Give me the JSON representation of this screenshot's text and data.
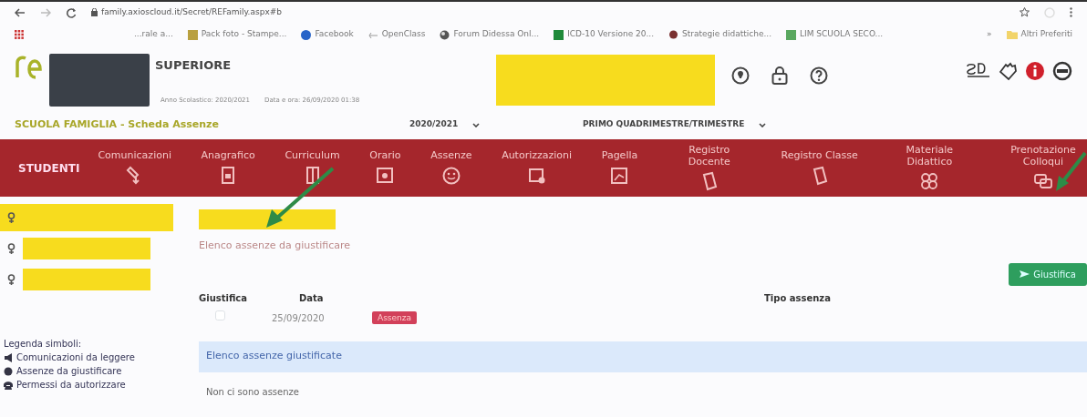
{
  "browser": {
    "url": "family.axioscloud.it/Secret/REFamily.aspx#b",
    "bookmarks": [
      {
        "label": "...rale a..."
      },
      {
        "label": "Pack foto - Stampe..."
      },
      {
        "label": "Facebook"
      },
      {
        "label": "OpenClass"
      },
      {
        "label": "Forum Didessa Onl..."
      },
      {
        "label": "ICD-10 Versione 20..."
      },
      {
        "label": "Strategie didattiche..."
      },
      {
        "label": "LIM SCUOLA SECO..."
      }
    ],
    "more": "»",
    "other": "Altri Preferiti"
  },
  "header": {
    "school": "SUPERIORE",
    "year_info": "Anno Scolastico: 2020/2021",
    "date_info": "Data e ora: 26/09/2020 01:38"
  },
  "page_title": "SCUOLA FAMIGLIA - Scheda Assenze",
  "year": "2020/2021",
  "period": "PRIMO QUADRIMESTRE/TRIMESTRE",
  "nav": {
    "brand": "STUDENTI",
    "items": [
      {
        "label": "Comunicazioni"
      },
      {
        "label": "Anagrafico"
      },
      {
        "label": "Curriculum"
      },
      {
        "label": "Orario"
      },
      {
        "label": "Assenze"
      },
      {
        "label": "Autorizzazioni"
      },
      {
        "label": "Pagella"
      },
      {
        "label": "Registro Docente"
      },
      {
        "label": "Registro Classe"
      },
      {
        "label": "Materiale Didattico"
      },
      {
        "label": "Prenotazione Colloqui"
      }
    ]
  },
  "students": [
    {
      "selected": true
    },
    {
      "selected": false
    },
    {
      "selected": false
    }
  ],
  "legend": {
    "title": "Legenda simboli:",
    "items": [
      "Comunicazioni da leggere",
      "Assenze da giustificare",
      "Permessi da autorizzare"
    ]
  },
  "to_justify": {
    "title": "Elenco assenze da giustificare",
    "button": "Giustifica",
    "columns": [
      "Giustifica",
      "Data",
      "Tipo assenza"
    ],
    "rows": [
      {
        "checked": false,
        "date": "25/09/2020",
        "type": "Assenza"
      }
    ]
  },
  "justified": {
    "title": "Elenco assenze giustificate",
    "empty": "Non ci sono assenze"
  }
}
